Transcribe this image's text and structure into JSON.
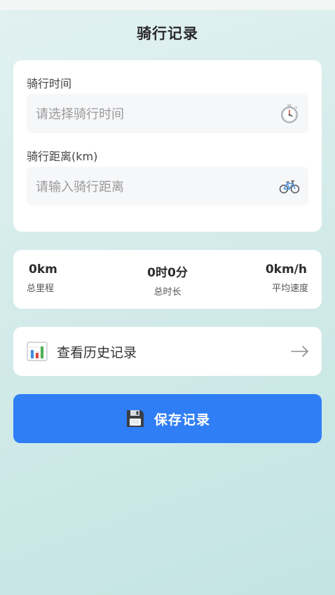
{
  "header": {
    "title": "骑行记录"
  },
  "form": {
    "time_label": "骑行时间",
    "time_placeholder": "请选择骑行时间",
    "time_icon": "stopwatch-icon",
    "distance_label": "骑行距离(km)",
    "distance_placeholder": "请输入骑行距离",
    "distance_icon": "bicycle-icon"
  },
  "stats": [
    {
      "value": "0km",
      "label": "总里程"
    },
    {
      "value": "0时0分",
      "label": "总时长"
    },
    {
      "value": "0km/h",
      "label": "平均速度"
    }
  ],
  "history": {
    "label": "查看历史记录",
    "icon": "bar-chart-icon",
    "arrow_icon": "arrow-right-icon"
  },
  "save": {
    "label": "保存记录",
    "icon": "floppy-disk-icon"
  },
  "colors": {
    "accent": "#2f7ef6",
    "card": "#ffffff",
    "field_bg": "#f6f7f9"
  }
}
